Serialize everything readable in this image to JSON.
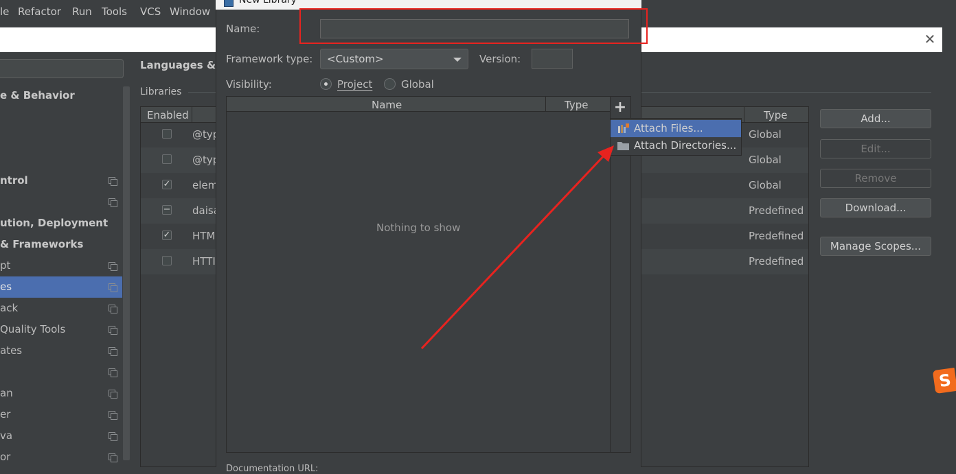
{
  "menubar": {
    "items": [
      {
        "label": "le"
      },
      {
        "label": "Refactor"
      },
      {
        "label": "Run"
      },
      {
        "label": "Tools"
      },
      {
        "label": "VCS"
      },
      {
        "label": "Window"
      }
    ]
  },
  "settings": {
    "close_glyph": "✕",
    "sidebar": {
      "items": [
        {
          "label": "e & Behavior",
          "bold": true
        },
        {
          "label": "",
          "bold": false
        },
        {
          "label": "",
          "bold": false
        },
        {
          "label": "",
          "bold": false
        },
        {
          "label": "ntrol",
          "bold": true,
          "copy": true
        },
        {
          "label": "",
          "bold": false,
          "copy": true
        },
        {
          "label": "ution, Deployment",
          "bold": true
        },
        {
          "label": " & Frameworks",
          "bold": true
        },
        {
          "label": "pt",
          "copy": true
        },
        {
          "label": "es",
          "copy": true,
          "selected": true
        },
        {
          "label": "ack",
          "copy": true
        },
        {
          "label": "Quality Tools",
          "copy": true
        },
        {
          "label": "ates",
          "copy": true
        },
        {
          "label": "",
          "copy": true
        },
        {
          "label": "an",
          "copy": true
        },
        {
          "label": "er",
          "copy": true
        },
        {
          "label": "va",
          "copy": true
        },
        {
          "label": "or",
          "copy": true
        }
      ]
    },
    "content_title": "Languages & F",
    "libraries_label": "Libraries",
    "table": {
      "headers": {
        "enabled": "Enabled",
        "type": "Type"
      },
      "rows": [
        {
          "check": "",
          "name": "@typ",
          "type": "Global"
        },
        {
          "check": "",
          "name": "@typ",
          "type": "Global"
        },
        {
          "check": "✓",
          "name": "elem",
          "type": "Global"
        },
        {
          "check": "−",
          "name": "daisa",
          "type": "Predefined"
        },
        {
          "check": "✓",
          "name": "HTM",
          "type": "Predefined"
        },
        {
          "check": "",
          "name": "HTTI",
          "type": "Predefined"
        }
      ]
    },
    "buttons": {
      "add": "Add...",
      "edit": "Edit...",
      "remove": "Remove",
      "download": "Download...",
      "manage_scopes": "Manage Scopes..."
    },
    "logo_letter": "S"
  },
  "new_library": {
    "title": "New Library",
    "name_label": "Name:",
    "name_value": "",
    "framework_label": "Framework type:",
    "framework_value": "<Custom>",
    "version_label": "Version:",
    "version_value": "",
    "visibility_label": "Visibility:",
    "visibility_options": [
      {
        "label": "Project",
        "selected": true
      },
      {
        "label": "Global",
        "selected": false
      }
    ],
    "roots_table": {
      "headers": {
        "name": "Name",
        "type": "Type"
      },
      "empty_text": "Nothing to show",
      "add_glyph": "+"
    },
    "popup": {
      "items": [
        {
          "label": "Attach Files...",
          "icon": "attach-files-icon",
          "highlighted": true
        },
        {
          "label": "Attach Directories...",
          "icon": "folder-icon",
          "highlighted": false
        }
      ]
    },
    "bottom_label": "Documentation URL:"
  },
  "colors": {
    "background": "#3c3f41",
    "selection": "#4b6eaf",
    "annotation_red": "#e8231f",
    "logo_orange": "#f26b1d"
  }
}
